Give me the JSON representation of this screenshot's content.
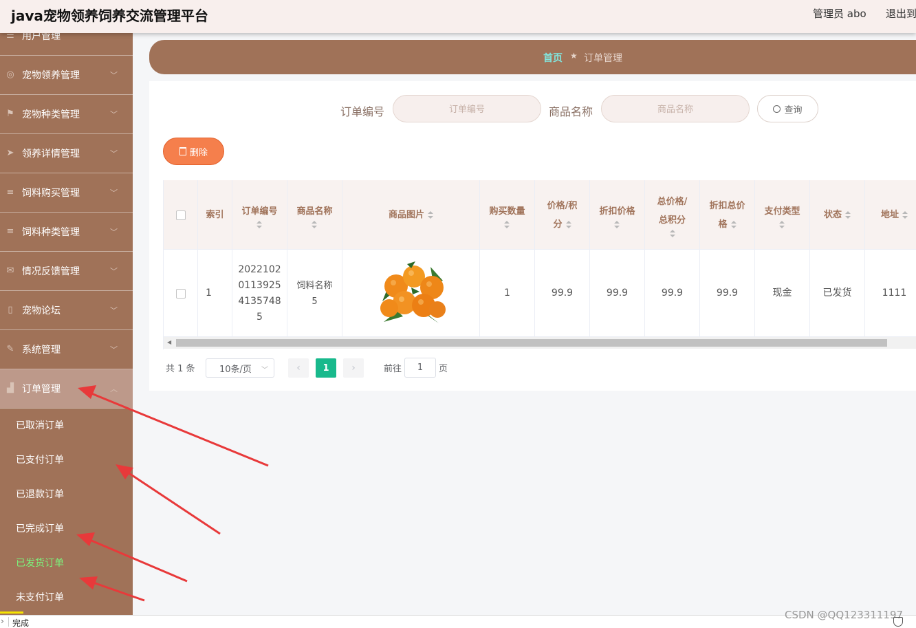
{
  "header": {
    "title": "java宠物领养饲养交流管理平台",
    "user": "管理员 abo",
    "logout": "退出到"
  },
  "sidebar": {
    "items": [
      {
        "label": "用户管理",
        "icon": "sliders-icon"
      },
      {
        "label": "宠物领养管理",
        "icon": "compass-icon"
      },
      {
        "label": "宠物种类管理",
        "icon": "flag-icon"
      },
      {
        "label": "领养详情管理",
        "icon": "send-icon"
      },
      {
        "label": "饲料购买管理",
        "icon": "list-icon"
      },
      {
        "label": "饲料种类管理",
        "icon": "list-icon"
      },
      {
        "label": "情况反馈管理",
        "icon": "mail-icon"
      },
      {
        "label": "宠物论坛",
        "icon": "microphone-icon"
      },
      {
        "label": "系统管理",
        "icon": "edit-icon"
      },
      {
        "label": "订单管理",
        "icon": "shop-icon"
      }
    ],
    "subitems": [
      "已取消订单",
      "已支付订单",
      "已退款订单",
      "已完成订单",
      "已发货订单",
      "未支付订单"
    ]
  },
  "breadcrumb": {
    "home": "首页",
    "current": "订单管理"
  },
  "search": {
    "order_no_label": "订单编号",
    "order_no_placeholder": "订单编号",
    "product_label": "商品名称",
    "product_placeholder": "商品名称",
    "query_button": "查询"
  },
  "actions": {
    "delete_button": "删除"
  },
  "table": {
    "headers": [
      "索引",
      "订单编号",
      "商品名称",
      "商品图片",
      "购买数量",
      "价格/积分",
      "折扣价格",
      "总价格/总积分",
      "折扣总价格",
      "支付类型",
      "状态",
      "地址"
    ],
    "rows": [
      {
        "index": "1",
        "order_no": "20221020113925413574 85",
        "order_no_lines": [
          "2022102",
          "0113925",
          "4135748",
          "5"
        ],
        "product_lines": [
          "饲料名称",
          "5"
        ],
        "image": "tangerines",
        "quantity": "1",
        "price": "99.9",
        "discount_price": "99.9",
        "total_price": "99.9",
        "discount_total": "99.9",
        "pay_type": "现金",
        "status": "已发货",
        "address": "1111"
      }
    ]
  },
  "pagination": {
    "total": "共 1 条",
    "page_size": "10条/页",
    "current_page": "1",
    "goto_label": "前往",
    "goto_value": "1",
    "page_suffix": "页"
  },
  "statusbar": {
    "text": "完成",
    "watermark": "CSDN @QQ123311197"
  },
  "colors": {
    "sidebar": "#a07258",
    "accent_active": "#18b98c",
    "delete": "#f57f4c",
    "arrow": "#e8393a"
  }
}
